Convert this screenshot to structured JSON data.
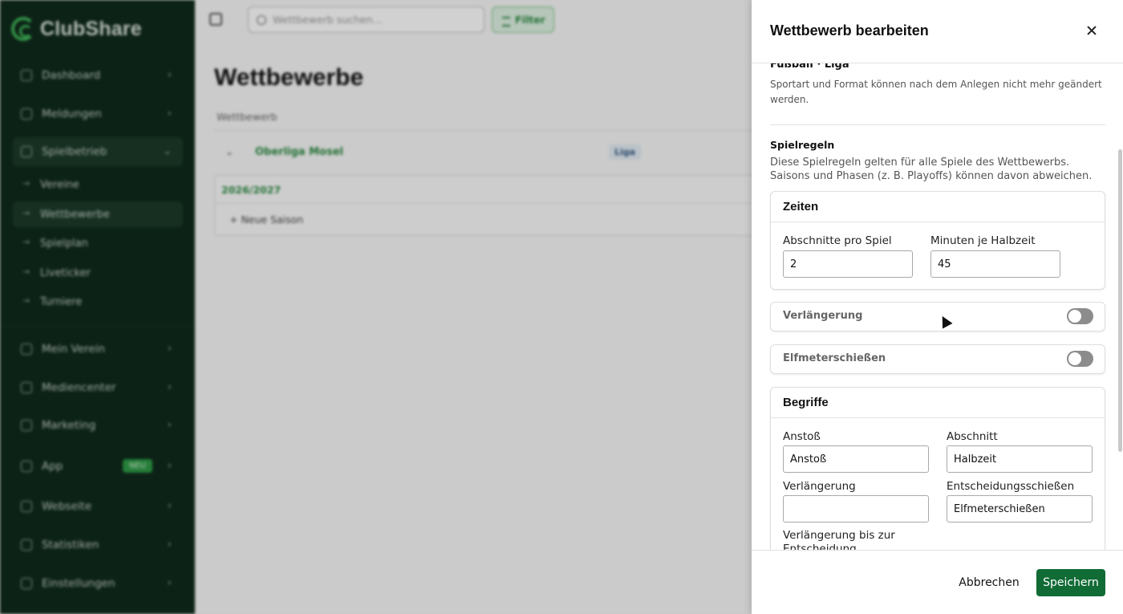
{
  "app": {
    "name": "ClubShare"
  },
  "sidebar": {
    "items": [
      {
        "label": "Dashboard",
        "icon": "home-icon"
      },
      {
        "label": "Meldungen",
        "icon": "news-icon"
      },
      {
        "label": "Spielbetrieb",
        "icon": "flag-icon"
      },
      {
        "label": "Mein Verein",
        "icon": "shield-icon"
      },
      {
        "label": "Mediencenter",
        "icon": "folder-icon"
      },
      {
        "label": "Marketing",
        "icon": "megaphone-icon"
      },
      {
        "label": "App",
        "icon": "phone-icon",
        "badge": "NEU"
      },
      {
        "label": "Webseite",
        "icon": "monitor-icon"
      },
      {
        "label": "Statistiken",
        "icon": "chart-icon"
      },
      {
        "label": "Einstellungen",
        "icon": "gear-icon"
      }
    ],
    "sub_items": [
      {
        "label": "Vereine"
      },
      {
        "label": "Wettbewerbe"
      },
      {
        "label": "Spielplan"
      },
      {
        "label": "Liveticker"
      },
      {
        "label": "Turniere"
      }
    ]
  },
  "topbar": {
    "search_placeholder": "Wettbewerb suchen...",
    "filter_label": "Filter"
  },
  "main": {
    "title": "Wettbewerbe",
    "column_header": "Wettbewerb",
    "competition": {
      "name": "Oberliga Mosel",
      "type_badge": "Liga"
    },
    "season": {
      "label": "2026/2027",
      "new_season_label": "+ Neue Saison"
    }
  },
  "drawer": {
    "title": "Wettbewerb bearbeiten",
    "sport_format": "Fußball · Liga",
    "sport_hint": "Sportart und Format können nach dem Anlegen nicht mehr geändert werden.",
    "rules_title": "Spielregeln",
    "rules_desc": "Diese Spielregeln gelten für alle Spiele des Wettbewerbs. Saisons und Phasen (z. B. Playoffs) können davon abweichen.",
    "zeiten": {
      "title": "Zeiten",
      "sections_label": "Abschnitte pro Spiel",
      "sections_value": "2",
      "minutes_label": "Minuten je Halbzeit",
      "minutes_value": "45"
    },
    "verlaengerung_toggle": {
      "label": "Verlängerung"
    },
    "elfmeter_toggle": {
      "label": "Elfmeterschießen"
    },
    "begriffe": {
      "title": "Begriffe",
      "anstoss_label": "Anstoß",
      "anstoss_value": "Anstoß",
      "abschnitt_label": "Abschnitt",
      "abschnitt_value": "Halbzeit",
      "verlaengerung_label": "Verlängerung",
      "verlaengerung_value": "",
      "entscheidung_label": "Entscheidungsschießen",
      "entscheidung_value": "Elfmeterschießen",
      "bis_entscheidung_label": "Verlängerung bis zur Entscheidung"
    },
    "footer": {
      "cancel_label": "Abbrechen",
      "save_label": "Speichern"
    }
  },
  "colors": {
    "sidebar_bg": "#0f2a1c",
    "accent_green": "#2d8a43",
    "save_button": "#116b35",
    "toggle_off": "#8c8c8c"
  }
}
